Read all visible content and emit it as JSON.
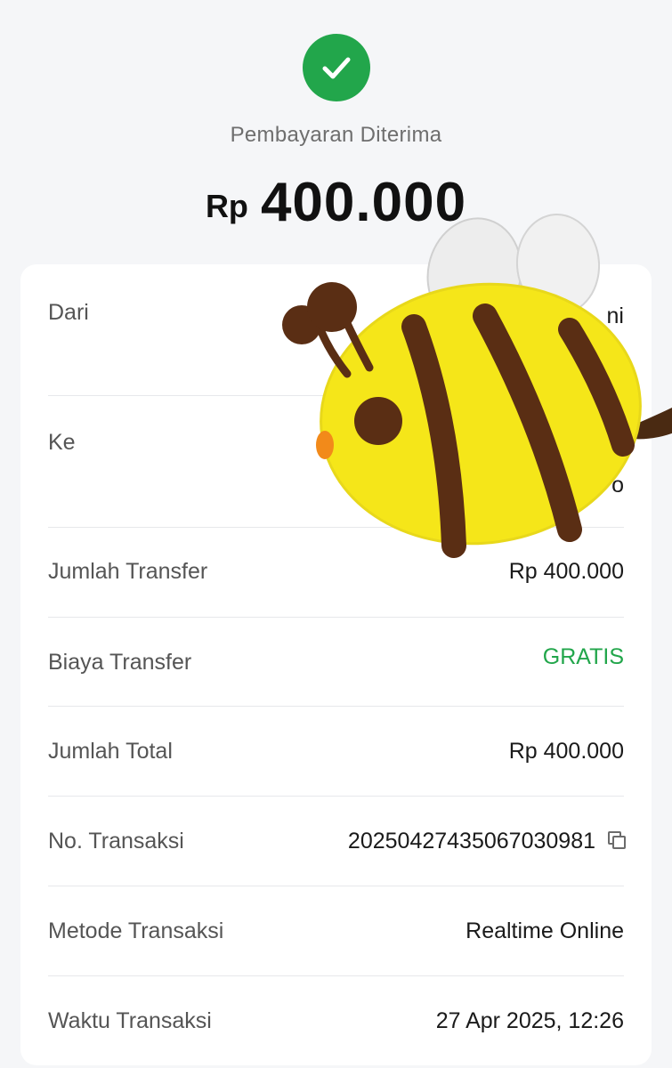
{
  "header": {
    "status_icon": "check-circle-icon",
    "status_color": "#22a64b",
    "status_text": "Pembayaran Diterima",
    "currency": "Rp",
    "amount": "400.000"
  },
  "details": {
    "from_label": "Dari",
    "from_value_partial": "ni",
    "to_label": "Ke",
    "to_value_partial": "o",
    "rows": [
      {
        "label": "Jumlah Transfer",
        "value": "Rp 400.000"
      },
      {
        "label": "Biaya Transfer",
        "value": "GRATIS"
      },
      {
        "label": "Jumlah Total",
        "value": "Rp 400.000"
      },
      {
        "label": "No. Transaksi",
        "value": "20250427435067030981"
      },
      {
        "label": "Metode Transaksi",
        "value": "Realtime Online"
      },
      {
        "label": "Waktu Transaksi",
        "value": "27 Apr 2025, 12:26"
      }
    ],
    "accent_green": "#22a64b"
  },
  "overlay": {
    "sticker": "bee-sticker"
  }
}
